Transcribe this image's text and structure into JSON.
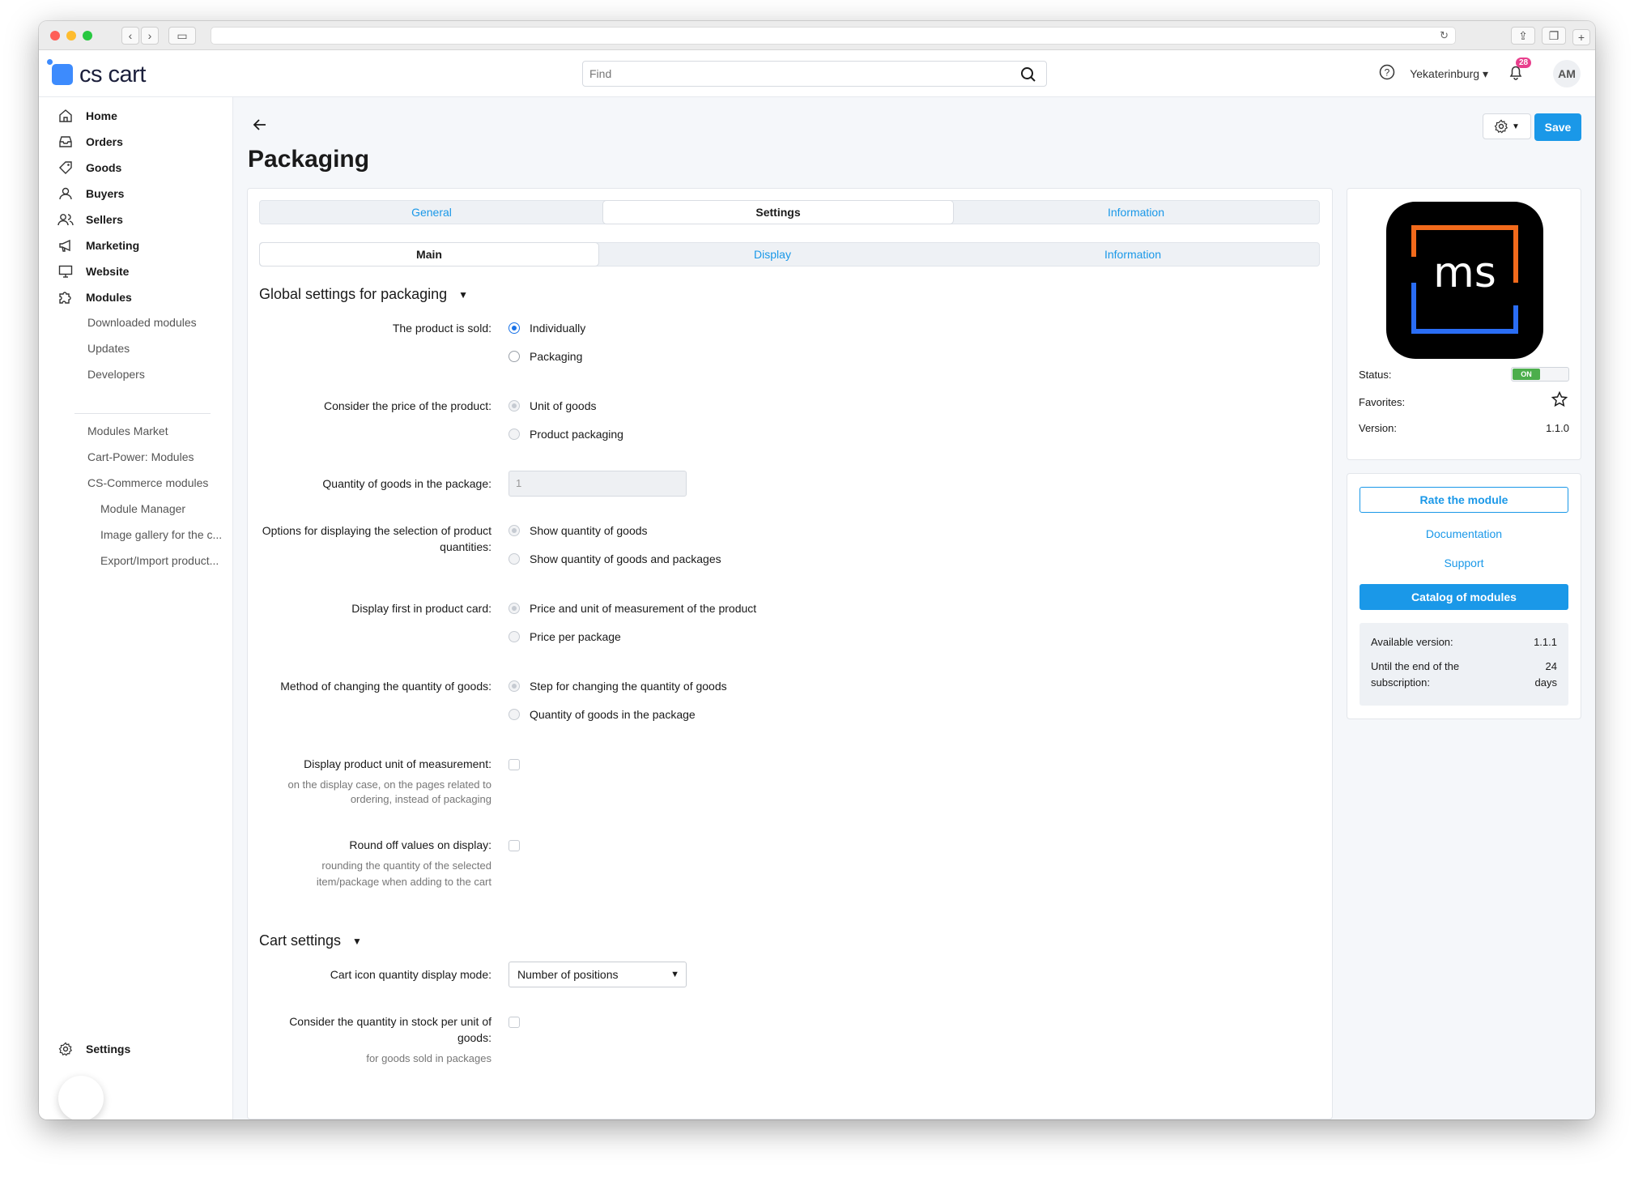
{
  "app": {
    "brand": "cs cart",
    "search_placeholder": "Find",
    "city": "Yekaterinburg",
    "notifications_count": "28",
    "avatar_initials": "AM"
  },
  "sidebar": {
    "items": [
      {
        "label": "Home",
        "icon": "home-icon"
      },
      {
        "label": "Orders",
        "icon": "inbox-icon"
      },
      {
        "label": "Goods",
        "icon": "tag-icon"
      },
      {
        "label": "Buyers",
        "icon": "user-icon"
      },
      {
        "label": "Sellers",
        "icon": "users-icon"
      },
      {
        "label": "Marketing",
        "icon": "megaphone-icon"
      },
      {
        "label": "Website",
        "icon": "monitor-icon"
      },
      {
        "label": "Modules",
        "icon": "puzzle-icon"
      }
    ],
    "sub_items": [
      "Downloaded modules",
      "Updates",
      "Developers",
      "Modules Market",
      "Cart-Power: Modules",
      "CS-Commerce modules"
    ],
    "sub_sub_items": [
      "Module Manager",
      "Image gallery for the c...",
      "Export/Import product..."
    ],
    "settings_label": "Settings"
  },
  "page": {
    "title": "Packaging",
    "save_label": "Save"
  },
  "tabs_top": [
    {
      "label": "General",
      "active": false
    },
    {
      "label": "Settings",
      "active": true
    },
    {
      "label": "Information",
      "active": false
    }
  ],
  "tabs_sub": [
    {
      "label": "Main",
      "active": true
    },
    {
      "label": "Display",
      "active": false
    },
    {
      "label": "Information",
      "active": false
    }
  ],
  "section_global": {
    "title": "Global settings for packaging",
    "sold_label": "The product is sold:",
    "sold_options": [
      "Individually",
      "Packaging"
    ],
    "price_label": "Consider the price of the product:",
    "price_options": [
      "Unit of goods",
      "Product packaging"
    ],
    "qty_label": "Quantity of goods in the package:",
    "qty_value": "1",
    "options_label_1": "Options for displaying the selection of product",
    "options_label_2": "quantities:",
    "options_options": [
      "Show quantity of goods",
      "Show quantity of goods and packages"
    ],
    "display_first_label": "Display first in product card:",
    "display_first_options": [
      "Price and unit of measurement of the product",
      "Price per package"
    ],
    "method_label": "Method of changing the quantity of goods:",
    "method_options": [
      "Step for changing the quantity of goods",
      "Quantity of goods in the package"
    ],
    "unit_label": "Display product unit of measurement:",
    "unit_hint_1": "on the display case, on the pages related to",
    "unit_hint_2": "ordering, instead of packaging",
    "round_label": "Round off values on display:",
    "round_hint_1": "rounding the quantity of the selected",
    "round_hint_2": "item/package when adding to the cart"
  },
  "section_cart": {
    "title": "Cart settings",
    "mode_label": "Cart icon quantity display mode:",
    "mode_value": "Number of positions",
    "stock_label_1": "Consider the quantity in stock per unit of",
    "stock_label_2": "goods:",
    "stock_hint": "for goods sold in packages"
  },
  "module_panel": {
    "logo_text": "ms",
    "status_label": "Status:",
    "status_value": "ON",
    "favorites_label": "Favorites:",
    "version_label": "Version:",
    "version_value": "1.1.0",
    "rate_label": "Rate the module",
    "docs_label": "Documentation",
    "support_label": "Support",
    "catalog_label": "Catalog of modules",
    "available_label": "Available version:",
    "available_value": "1.1.1",
    "until_label_1": "Until the end of the",
    "until_label_2": "subscription:",
    "until_value_1": "24",
    "until_value_2": "days"
  },
  "colors": {
    "accent": "#1a98e8",
    "status_on": "#4cae4c",
    "badge": "#e83e8c",
    "logo_blue": "#3d8bfd"
  }
}
